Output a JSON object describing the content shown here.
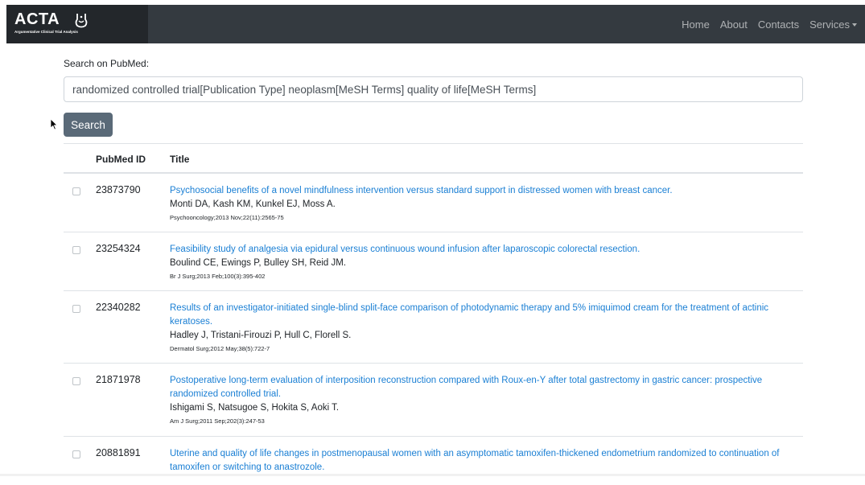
{
  "navbar": {
    "brand": "ACTA",
    "brand_subtitle": "Argumentative Clinical Trial Analysis",
    "links": {
      "home": "Home",
      "about": "About",
      "contacts": "Contacts",
      "services": "Services"
    },
    "colors": {
      "background": "#343a40",
      "brand_background": "#23272b"
    }
  },
  "search": {
    "label": "Search on PubMed:",
    "value": "randomized controlled trial[Publication Type] neoplasm[MeSH Terms] quality of life[MeSH Terms]",
    "button_label": "Search"
  },
  "table": {
    "headers": {
      "id": "PubMed ID",
      "title": "Title"
    },
    "rows": [
      {
        "id": "23873790",
        "title": "Psychosocial benefits of a novel mindfulness intervention versus standard support in distressed women with breast cancer.",
        "authors": "Monti DA, Kash KM, Kunkel EJ, Moss A.",
        "journal": "Psychooncology;2013 Nov;22(11):2565-75"
      },
      {
        "id": "23254324",
        "title": "Feasibility study of analgesia via epidural versus continuous wound infusion after laparoscopic colorectal resection.",
        "authors": "Boulind CE, Ewings P, Bulley SH, Reid JM.",
        "journal": "Br J Surg;2013 Feb;100(3):395-402"
      },
      {
        "id": "22340282",
        "title": "Results of an investigator-initiated single-blind split-face comparison of photodynamic therapy and 5% imiquimod cream for the treatment of actinic keratoses.",
        "authors": "Hadley J, Tristani-Firouzi P, Hull C, Florell S.",
        "journal": "Dermatol Surg;2012 May;38(5):722-7"
      },
      {
        "id": "21871978",
        "title": "Postoperative long-term evaluation of interposition reconstruction compared with Roux-en-Y after total gastrectomy in gastric cancer: prospective randomized controlled trial.",
        "authors": "Ishigami S, Natsugoe S, Hokita S, Aoki T.",
        "journal": "Am J Surg;2011 Sep;202(3):247-53"
      },
      {
        "id": "20881891",
        "title": "Uterine and quality of life changes in postmenopausal women with an asymptomatic tamoxifen-thickened endometrium randomized to continuation of tamoxifen or switching to anastrozole.",
        "authors": "",
        "journal": ""
      }
    ],
    "colors": {
      "link": "#1a7fd4",
      "border": "#dee2e6"
    }
  }
}
